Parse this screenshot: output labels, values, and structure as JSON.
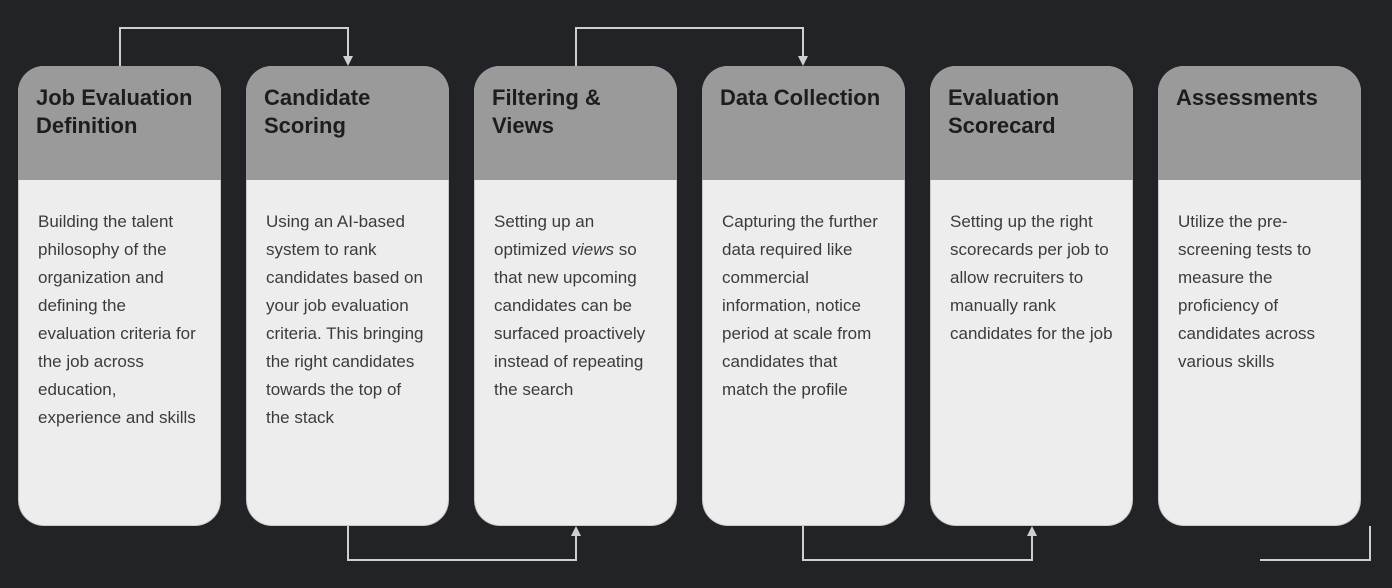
{
  "cards": [
    {
      "title": "Job Evaluation Definition",
      "body": "Building the talent philosophy of the organization and defining the evaluation criteria for the job across education, experience and skills"
    },
    {
      "title": "Candidate Scoring",
      "body": "Using an AI-based system to rank candidates based on your job evaluation criteria. This bringing the right candidates towards the top of the stack"
    },
    {
      "title": "Filtering & Views",
      "body": "Setting up an optimized <em>views</em> so that new upcoming candidates can be surfaced proactively instead of repeating the search"
    },
    {
      "title": "Data Collection",
      "body": "Capturing the further data required like commercial information, notice period at scale from candidates that match the profile"
    },
    {
      "title": "Evaluation Scorecard",
      "body": "Setting up the right scorecards per job to allow recruiters to manually rank candidates for the job"
    },
    {
      "title": "Assessments",
      "body": "Utilize the pre-screening tests to measure the proficiency of candidates across various skills"
    }
  ]
}
